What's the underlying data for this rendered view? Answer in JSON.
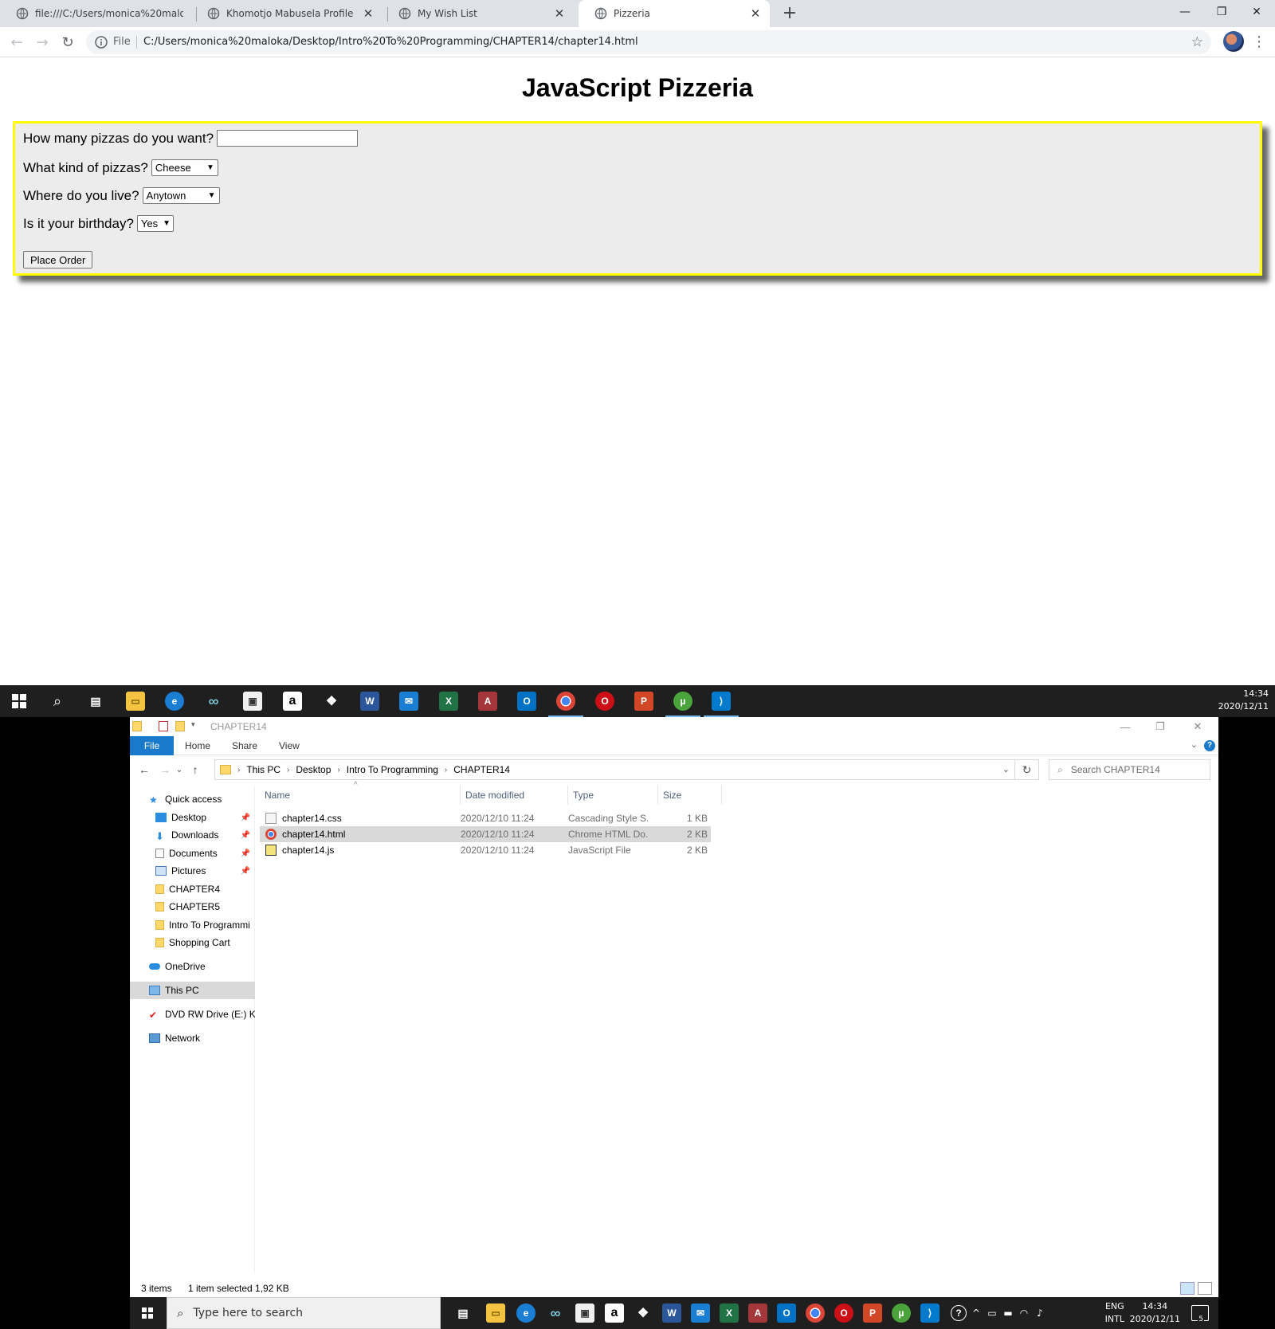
{
  "browser": {
    "tabs": [
      {
        "title": "file:///C:/Users/monica%20malok",
        "active": false
      },
      {
        "title": "Khomotjo Mabusela Profile",
        "active": false
      },
      {
        "title": "My Wish List",
        "active": false
      },
      {
        "title": "Pizzeria",
        "active": true
      }
    ],
    "new_tab_label": "+",
    "omnibox": {
      "scheme_label": "File",
      "url": "C:/Users/monica%20maloka/Desktop/Intro%20To%20Programming/CHAPTER14/chapter14.html"
    }
  },
  "page": {
    "title": "JavaScript Pizzeria",
    "form": {
      "qty_label": "How many pizzas do you want?",
      "qty_value": "",
      "kind_label": "What kind of pizzas?",
      "kind_selected": "Cheese",
      "location_label": "Where do you live?",
      "location_selected": "Anytown",
      "birthday_label": "Is it your birthday?",
      "birthday_selected": "Yes",
      "submit_label": "Place Order"
    }
  },
  "taskbar_top": {
    "time": "14:34",
    "date": "2020/12/11"
  },
  "explorer": {
    "title": "CHAPTER14",
    "ribbon_tabs": [
      "File",
      "Home",
      "Share",
      "View"
    ],
    "help_label": "?",
    "breadcrumb": [
      "This PC",
      "Desktop",
      "Intro To Programming",
      "CHAPTER14"
    ],
    "search_placeholder": "Search CHAPTER14",
    "nav": {
      "quick_access": "Quick access",
      "desktop": "Desktop",
      "downloads": "Downloads",
      "documents": "Documents",
      "pictures": "Pictures",
      "chapter4": "CHAPTER4",
      "chapter5": "CHAPTER5",
      "intro": "Intro To Programmi",
      "shopping": "Shopping Cart",
      "onedrive": "OneDrive",
      "thispc": "This PC",
      "dvd": "DVD RW Drive (E:) KIS",
      "network": "Network"
    },
    "columns": {
      "name": "Name",
      "date": "Date modified",
      "type": "Type",
      "size": "Size"
    },
    "files": [
      {
        "name": "chapter14.css",
        "date": "2020/12/10 11:24",
        "type": "Cascading Style S...",
        "size": "1 KB"
      },
      {
        "name": "chapter14.html",
        "date": "2020/12/10 11:24",
        "type": "Chrome HTML Do...",
        "size": "2 KB"
      },
      {
        "name": "chapter14.js",
        "date": "2020/12/10 11:24",
        "type": "JavaScript File",
        "size": "2 KB"
      }
    ],
    "status_items": "3 items",
    "status_selected": "1 item selected  1,92 KB"
  },
  "taskbar_bottom": {
    "search_placeholder": "Type here to search",
    "lang_1": "ENG",
    "lang_2": "INTL",
    "time": "14:34",
    "date": "2020/12/11",
    "notification_count": "5"
  },
  "colors": {
    "form_border": "#ffff00",
    "form_bg": "#ececec",
    "explorer_file_tab": "#1979ca"
  }
}
